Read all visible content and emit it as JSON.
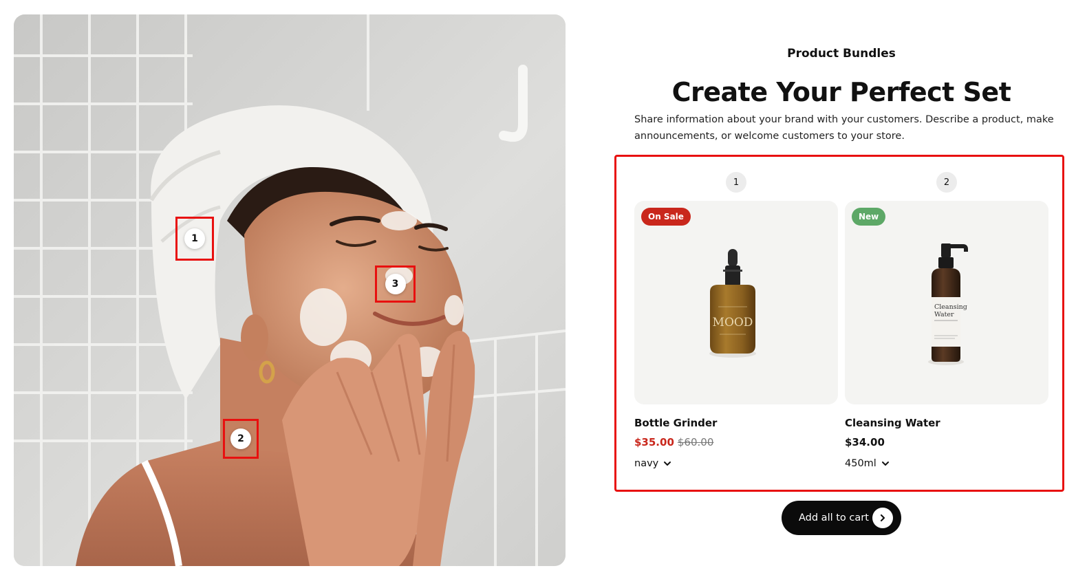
{
  "section": {
    "eyebrow": "Product Bundles",
    "heading": "Create Your Perfect Set",
    "description": "Share information about your brand with your customers. Describe a product, make announcements, or welcome customers to your store."
  },
  "hotspots": [
    {
      "label": "1"
    },
    {
      "label": "2"
    },
    {
      "label": "3"
    }
  ],
  "products": [
    {
      "step": "1",
      "badge": "On Sale",
      "badge_color": "#c9271c",
      "title": "Bottle Grinder",
      "price": "$35.00",
      "compare_price": "$60.00",
      "variant": "navy",
      "bottle_label": "MOOD"
    },
    {
      "step": "2",
      "badge": "New",
      "badge_color": "#5da867",
      "title": "Cleansing Water",
      "price": "$34.00",
      "variant": "450ml",
      "bottle_label_line1": "Cleansing",
      "bottle_label_line2": "Water"
    }
  ],
  "cart": {
    "label": "Add all to cart",
    "icon": "chevron-right-icon"
  },
  "colors": {
    "highlight": "#e8100f",
    "sale": "#c9271c",
    "new": "#5da867",
    "button": "#0b0b0b"
  }
}
